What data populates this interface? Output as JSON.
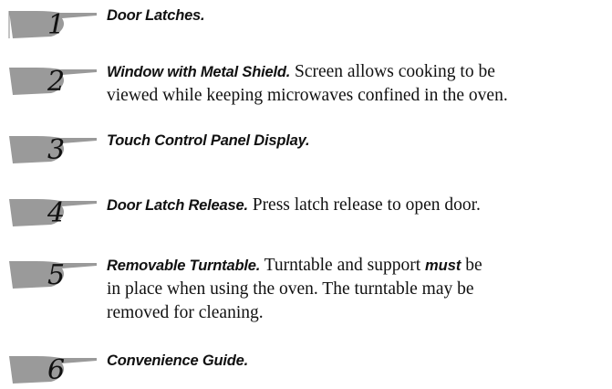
{
  "items": [
    {
      "number": "1",
      "title": "Door Latches.",
      "lines": []
    },
    {
      "number": "2",
      "title": "Window with Metal Shield.",
      "lines": [
        {
          "after_title": " Screen allows cooking to be"
        },
        {
          "text": "viewed while keeping microwaves confined in the oven."
        }
      ]
    },
    {
      "number": "3",
      "title": "Touch Control Panel Display.",
      "lines": []
    },
    {
      "number": "4",
      "title": "Door Latch Release.",
      "lines": [
        {
          "after_title": " Press latch release to open door."
        }
      ]
    },
    {
      "number": "5",
      "title": "Removable Turntable.",
      "lines": [
        {
          "after_title": " Turntable and support ",
          "emphasis": "must",
          "tail": " be"
        },
        {
          "text": "in place when using the oven. The turntable may be"
        },
        {
          "text": "removed for cleaning."
        }
      ]
    },
    {
      "number": "6",
      "title": "Convenience Guide.",
      "lines": []
    }
  ],
  "hand_icon_color": "#9a9a9a"
}
